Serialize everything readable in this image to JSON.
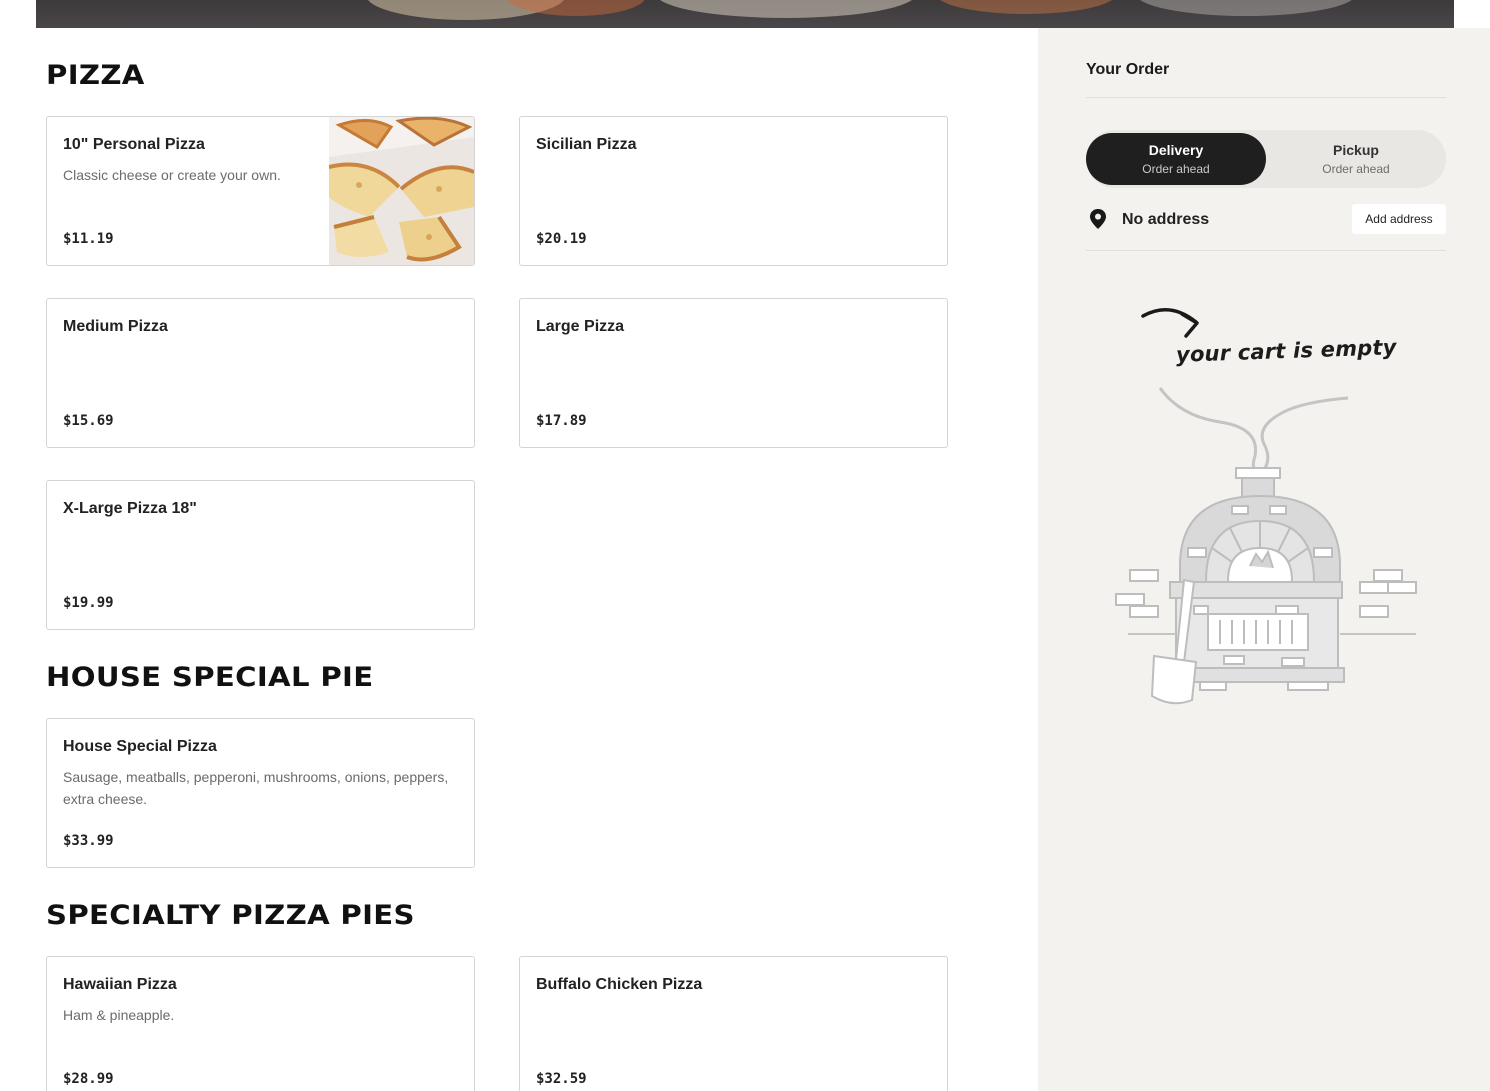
{
  "sections": [
    {
      "title": "PIZZA",
      "items": [
        {
          "name": "10\" Personal Pizza",
          "description": "Classic cheese or create your own.",
          "price": "$11.19",
          "has_image": true
        },
        {
          "name": "Sicilian Pizza",
          "description": "",
          "price": "$20.19",
          "has_image": false
        },
        {
          "name": "Medium Pizza",
          "description": "",
          "price": "$15.69",
          "has_image": false
        },
        {
          "name": "Large Pizza",
          "description": "",
          "price": "$17.89",
          "has_image": false
        },
        {
          "name": "X-Large Pizza 18\"",
          "description": "",
          "price": "$19.99",
          "has_image": false
        }
      ]
    },
    {
      "title": "HOUSE SPECIAL PIE",
      "items": [
        {
          "name": "House Special Pizza",
          "description": "Sausage, meatballs, pepperoni, mushrooms, onions, peppers, extra cheese.",
          "price": "$33.99",
          "has_image": false
        }
      ]
    },
    {
      "title": "SPECIALTY PIZZA PIES",
      "items": [
        {
          "name": "Hawaiian Pizza",
          "description": "Ham & pineapple.",
          "price": "$28.99",
          "has_image": false
        },
        {
          "name": "Buffalo Chicken Pizza",
          "description": "",
          "price": "$32.59",
          "has_image": false
        }
      ]
    }
  ],
  "order": {
    "title": "Your Order",
    "modes": [
      {
        "label": "Delivery",
        "sub": "Order ahead",
        "active": true
      },
      {
        "label": "Pickup",
        "sub": "Order ahead",
        "active": false
      }
    ],
    "address": "No address",
    "add_address_label": "Add address",
    "empty_text": "your cart is empty"
  },
  "icons": {
    "address": "map-pin-icon",
    "arrow": "curved-arrow-icon"
  },
  "colors": {
    "accent_dark": "#1f1f1f",
    "sidebar_bg": "#f3f2ef",
    "border": "#d4d4d4"
  }
}
